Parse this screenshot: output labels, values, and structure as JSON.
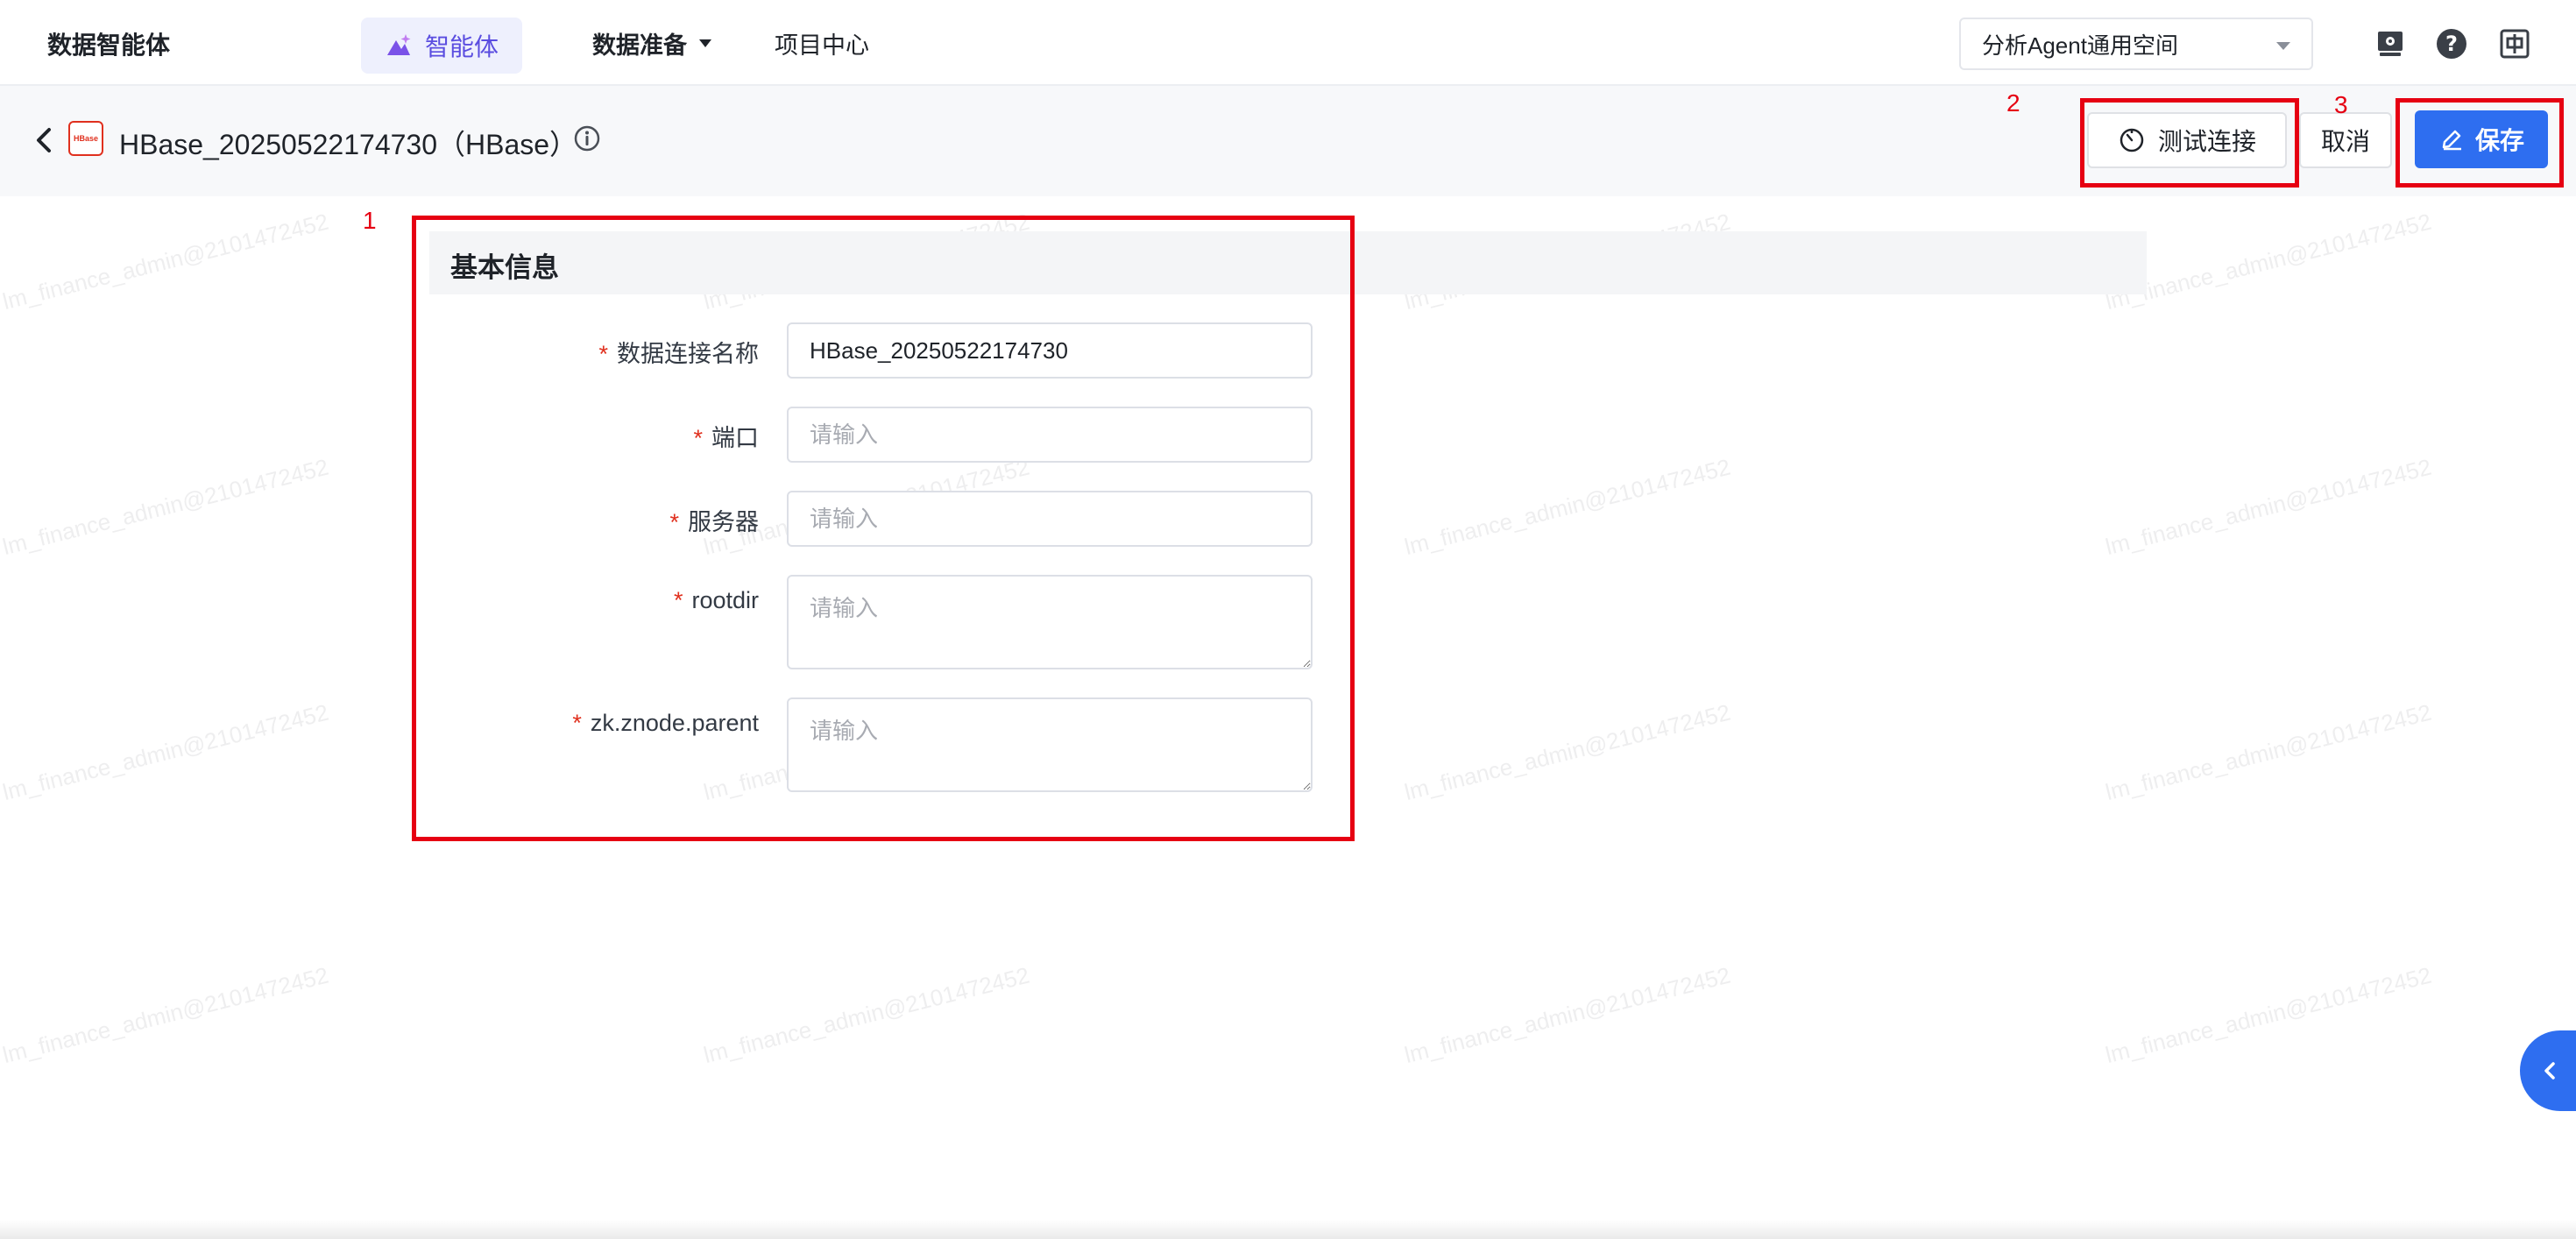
{
  "nav": {
    "app_title": "数据智能体",
    "agent_tab": "智能体",
    "data_prep": "数据准备",
    "project_center": "项目中心",
    "workspace": "分析Agent通用空间"
  },
  "header": {
    "connection_title": "HBase_20250522174730（HBase）",
    "logo_text": "HBase",
    "test_connection": "测试连接",
    "cancel": "取消",
    "save": "保存"
  },
  "section": {
    "title": "基本信息"
  },
  "form": {
    "required_mark": "*",
    "fields": [
      {
        "label": "数据连接名称",
        "value": "HBase_20250522174730",
        "placeholder": ""
      },
      {
        "label": "端口",
        "value": "",
        "placeholder": "请输入"
      },
      {
        "label": "服务器",
        "value": "",
        "placeholder": "请输入"
      },
      {
        "label": "rootdir",
        "value": "",
        "placeholder": "请输入"
      },
      {
        "label": "zk.znode.parent",
        "value": "",
        "placeholder": "请输入"
      }
    ]
  },
  "annotations": [
    "1",
    "2",
    "3"
  ],
  "watermark": "lm_finance_admin@2101472452",
  "colors": {
    "primary": "#2e6ef0",
    "agent_accent": "#5a4de0",
    "annotation_red": "#e60012",
    "required_red": "#e0301e"
  }
}
